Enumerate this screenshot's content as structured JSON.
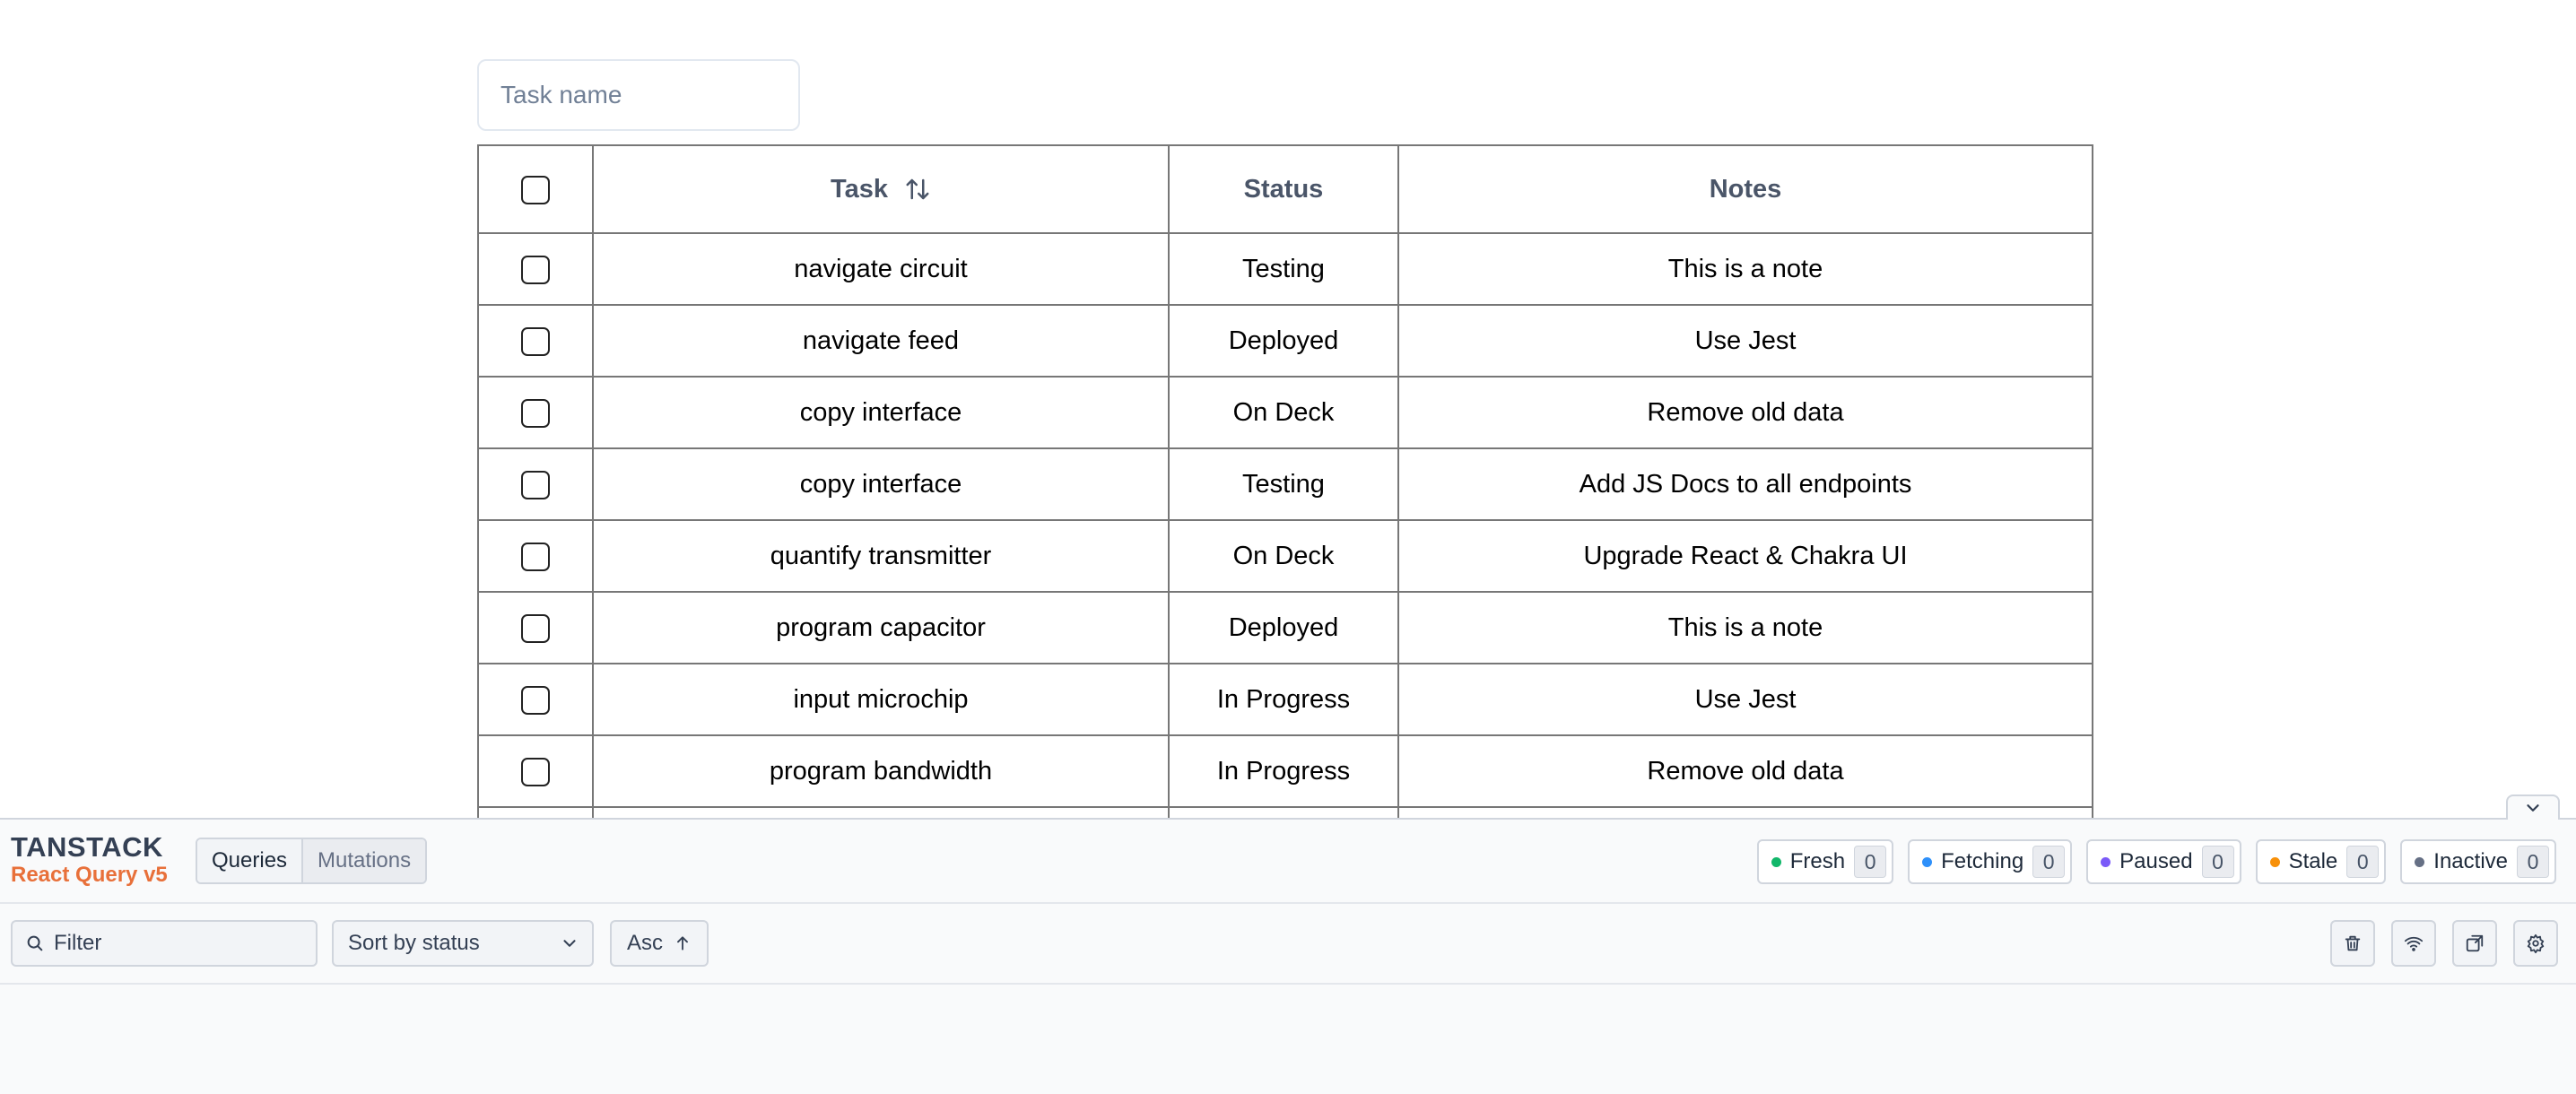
{
  "task_filter": {
    "placeholder": "Task name",
    "value": ""
  },
  "table": {
    "headers": {
      "task": "Task",
      "status": "Status",
      "notes": "Notes"
    },
    "rows": [
      {
        "task": "navigate circuit",
        "status": "Testing",
        "notes": "This is a note"
      },
      {
        "task": "navigate feed",
        "status": "Deployed",
        "notes": "Use Jest"
      },
      {
        "task": "copy interface",
        "status": "On Deck",
        "notes": "Remove old data"
      },
      {
        "task": "copy interface",
        "status": "Testing",
        "notes": "Add JS Docs to all endpoints"
      },
      {
        "task": "quantify transmitter",
        "status": "On Deck",
        "notes": "Upgrade React & Chakra UI"
      },
      {
        "task": "program capacitor",
        "status": "Deployed",
        "notes": "This is a note"
      },
      {
        "task": "input microchip",
        "status": "In Progress",
        "notes": "Use Jest"
      },
      {
        "task": "program bandwidth",
        "status": "In Progress",
        "notes": "Remove old data"
      },
      {
        "task": "",
        "status": "",
        "notes": ""
      }
    ]
  },
  "devtools": {
    "logo_line1": "TANSTACK",
    "logo_line2": "React Query v5",
    "tabs": {
      "queries": "Queries",
      "mutations": "Mutations"
    },
    "status_pills": [
      {
        "label": "Fresh",
        "count": "0",
        "color": "#12b76a"
      },
      {
        "label": "Fetching",
        "count": "0",
        "color": "#2e90fa"
      },
      {
        "label": "Paused",
        "count": "0",
        "color": "#7a5af8"
      },
      {
        "label": "Stale",
        "count": "0",
        "color": "#f79009"
      },
      {
        "label": "Inactive",
        "count": "0",
        "color": "#667085"
      }
    ],
    "filter_placeholder": "Filter",
    "sort_value": "Sort by status",
    "asc_label": "Asc",
    "icons": [
      "trash-icon",
      "wifi-icon",
      "popout-icon",
      "settings-icon"
    ]
  }
}
